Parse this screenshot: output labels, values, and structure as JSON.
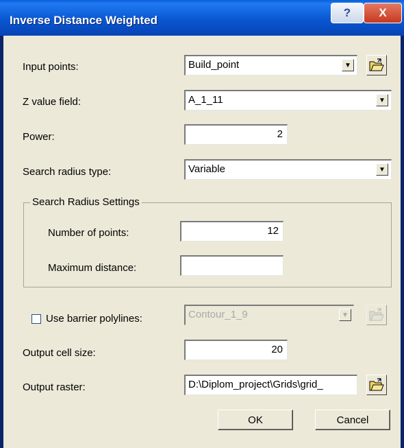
{
  "window": {
    "title": "Inverse Distance Weighted",
    "help_glyph": "?",
    "close_glyph": "X"
  },
  "form": {
    "input_points": {
      "label": "Input points:",
      "value": "Build_point"
    },
    "z_value_field": {
      "label": "Z value field:",
      "value": "A_1_11"
    },
    "power": {
      "label": "Power:",
      "value": "2"
    },
    "search_radius_type": {
      "label": "Search radius type:",
      "value": "Variable"
    },
    "search_radius_settings": {
      "title": "Search Radius Settings",
      "number_of_points": {
        "label": "Number of points:",
        "value": "12"
      },
      "maximum_distance": {
        "label": "Maximum distance:",
        "value": ""
      }
    },
    "use_barrier_polylines": {
      "label": "Use barrier polylines:",
      "checked": false,
      "value": "Contour_1_9"
    },
    "output_cell_size": {
      "label": "Output cell size:",
      "value": "20"
    },
    "output_raster": {
      "label": "Output raster:",
      "value": "D:\\Diplom_project\\Grids\\grid_"
    }
  },
  "buttons": {
    "ok": "OK",
    "cancel": "Cancel"
  },
  "icons": {
    "open_folder": "open-folder-icon",
    "dropdown": "chevron-down-icon",
    "help": "help-icon",
    "close": "close-icon"
  }
}
